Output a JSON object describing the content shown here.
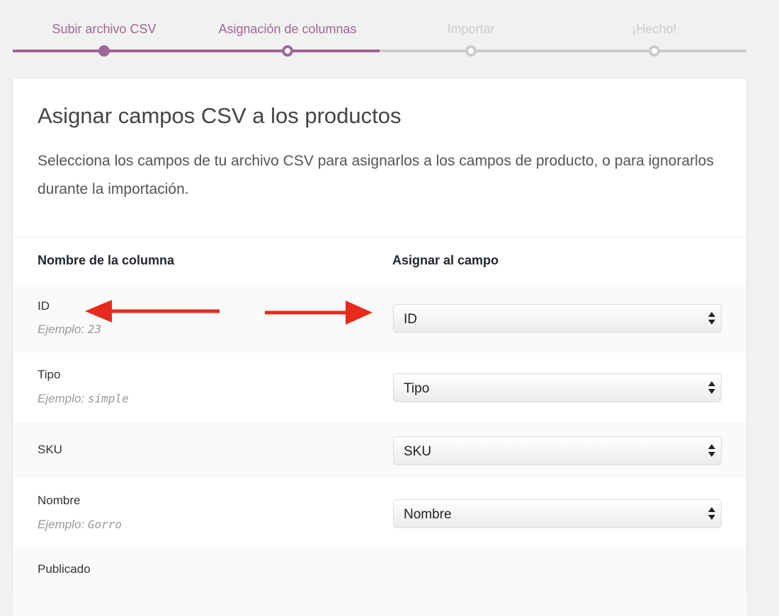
{
  "steps": [
    {
      "label": "Subir archivo CSV",
      "state": "done"
    },
    {
      "label": "Asignación de columnas",
      "state": "active"
    },
    {
      "label": "Importar",
      "state": "pending"
    },
    {
      "label": "¡Hecho!",
      "state": "pending"
    }
  ],
  "card": {
    "title": "Asignar campos CSV a los productos",
    "description": "Selecciona los campos de tu archivo CSV para asignarlos a los campos de producto, o para ignorarlos durante la importación."
  },
  "table": {
    "column_name_header": "Nombre de la columna",
    "map_to_header": "Asignar al campo",
    "example_prefix": "Ejemplo:",
    "rows": [
      {
        "name": "ID",
        "example": "23",
        "mapped": "ID"
      },
      {
        "name": "Tipo",
        "example": "simple",
        "mapped": "Tipo"
      },
      {
        "name": "SKU",
        "example": "",
        "mapped": "SKU"
      },
      {
        "name": "Nombre",
        "example": "Gorro",
        "mapped": "Nombre"
      },
      {
        "name": "Publicado",
        "example": "",
        "mapped": ""
      }
    ]
  },
  "colors": {
    "accent": "#a16696",
    "inactive": "#cccccc",
    "annotation_arrow": "#e8291c"
  }
}
